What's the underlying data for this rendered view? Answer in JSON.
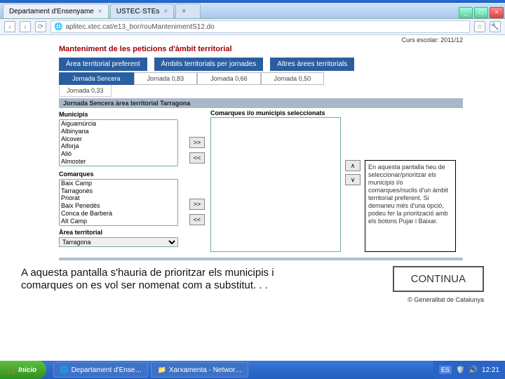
{
  "browser": {
    "tabs": [
      {
        "label": "Departament d'Ensenyame"
      },
      {
        "label": "USTEC·STEs"
      }
    ],
    "url": "aplitec.xtec.cat/e13_bor/rouMantenimentS12.do",
    "win": {
      "min": "_",
      "max": "□",
      "close": "×"
    }
  },
  "page": {
    "curs": "Curs escolar: 2011/12",
    "title": "Manteniment de les peticions d'àmbit territorial",
    "main_tabs": [
      "Àrea territorial preferent",
      "Àmbits territorials per jornades",
      "Altres àrees territorials"
    ],
    "sub_tabs": [
      "Jornada Sencera",
      "Jornada 0,83",
      "Jornada 0,66",
      "Jornada 0,50"
    ],
    "sub2": [
      "Jornada 0,33"
    ],
    "bar_header": "Jornada Sencera àrea territorial Tarragona",
    "municipis_label": "Municipis",
    "municipis": [
      "Aiguamúrcia",
      "Albinyana",
      "Alcover",
      "Alforja",
      "Alió",
      "Almoster"
    ],
    "comarques_label": "Comarques",
    "comarques": [
      "Baix Camp",
      "Tarragonès",
      "Priorat",
      "Baix Penedès",
      "Conca de Barberà",
      "Alt Camp"
    ],
    "sel_header": "Comarques i/o municipis seleccionats",
    "area_label": "Àrea territorial",
    "area_options": [
      "Tarragona"
    ],
    "arrows": {
      "add": ">>",
      "remove": "<<",
      "up": "∧",
      "down": "∨"
    },
    "note": "En aquesta pantalla heu de seleccionar/prioritzar els municipis i/o comarques/nuclis d'un àmbit territorial preferent. Si demaneu més d'una opció, podeu fer la priorització amb els botons Pujar i Baixar.",
    "footer": "© Generalitat de Catalunya"
  },
  "caption": {
    "text": "A aquesta pantalla s'hauria de prioritzar els municipis i comarques on es vol ser nomenat com a substitut. . .",
    "continua": "CONTINUA"
  },
  "taskbar": {
    "start": "Inicio",
    "items": [
      "Departament d'Ense…",
      "Xarxamenta - Networ…"
    ],
    "lang": "ES",
    "time": "12:21"
  }
}
